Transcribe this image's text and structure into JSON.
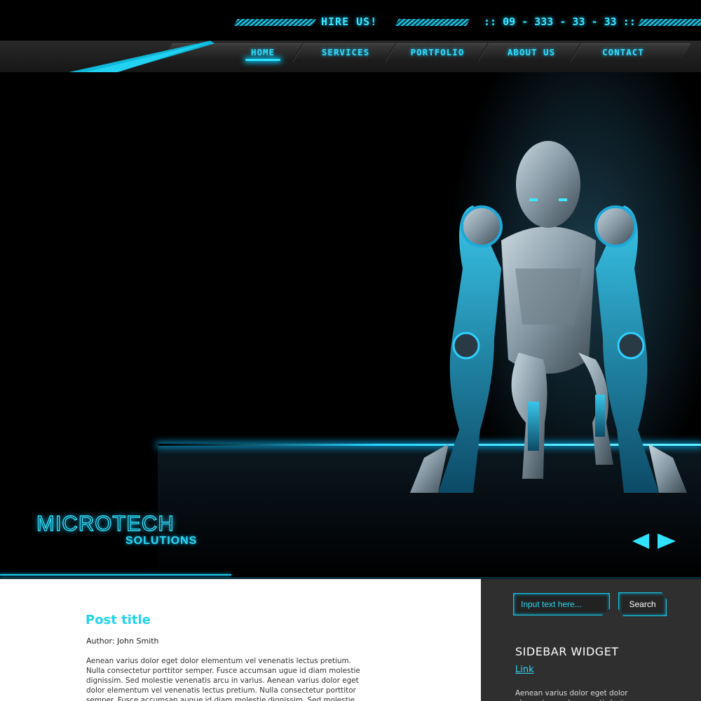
{
  "header": {
    "hire_label": "HIRE US!",
    "phone": ":: 09 - 333 - 33 - 33 ::"
  },
  "nav": {
    "items": [
      {
        "label": "HOME",
        "active": true
      },
      {
        "label": "SERVICES",
        "active": false
      },
      {
        "label": "PORTFOLIO",
        "active": false
      },
      {
        "label": "ABOUT US",
        "active": false
      },
      {
        "label": "CONTACT",
        "active": false
      }
    ]
  },
  "hero": {
    "brand_main": "MICROTECH",
    "brand_sub": "SOLUTIONS",
    "prev_icon": "triangle-left-icon",
    "next_icon": "triangle-right-icon"
  },
  "post": {
    "title": "Post title",
    "author": "Author: John Smith",
    "body": "Aenean varius dolor eget dolor elementum vel venenatis lectus pretium. Nulla consectetur porttitor semper. Fusce accumsan ugue id diam molestie dignissim. Sed molestie venenatis arcu in varius. Aenean varius dolor eget dolor elementum vel venenatis lectus pretium. Nulla consectetur porttitor semper. Fusce accumsan augue id diam molestie dignissim. Sed molestie"
  },
  "sidebar": {
    "search_placeholder": "Input text here...",
    "search_button": "Search",
    "widget_title": "SIDEBAR WIDGET",
    "widget_link": "Link",
    "widget_text": "Aenean varius dolor eget dolor elementum vel venenatis lectus"
  },
  "colors": {
    "accent": "#2fe3ff",
    "background": "#000000",
    "sidebar": "#2f2f2f"
  }
}
